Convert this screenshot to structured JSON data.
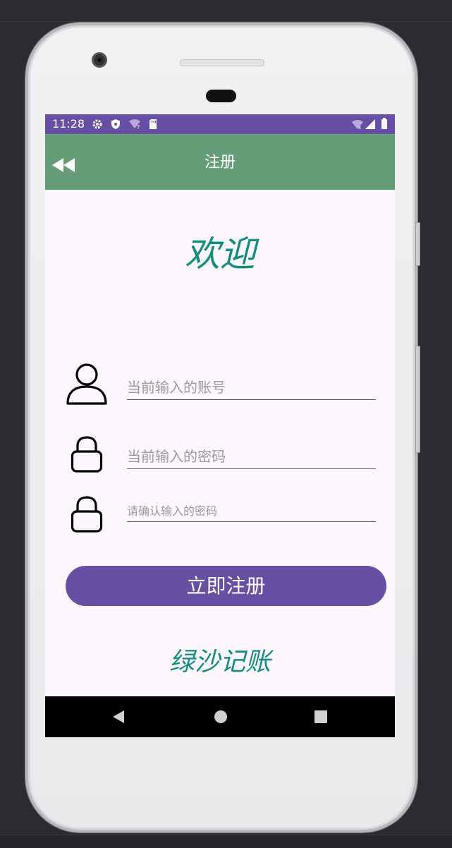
{
  "status_bar": {
    "time": "11:28",
    "icons": [
      "settings-icon",
      "shield-icon",
      "wifi-question-icon",
      "sd-card-icon",
      "wifi-off-icon",
      "signal-icon",
      "battery-icon"
    ]
  },
  "app_bar": {
    "title": "注册",
    "back_icon": "rewind-icon"
  },
  "welcome": "欢迎",
  "form": {
    "account_placeholder": "当前输入的账号",
    "password_placeholder": "当前输入的密码",
    "confirm_placeholder": "请确认输入的密码",
    "account_icon": "user-icon",
    "password_icon": "lock-icon"
  },
  "register_button": "立即注册",
  "brand": "绿沙记账",
  "colors": {
    "primary": "#6750a4",
    "app_bar": "#669c78",
    "accent_text": "#138d7e",
    "background": "#fef7fe"
  },
  "nav_bar": [
    "back-triangle-icon",
    "home-circle-icon",
    "recents-square-icon"
  ]
}
